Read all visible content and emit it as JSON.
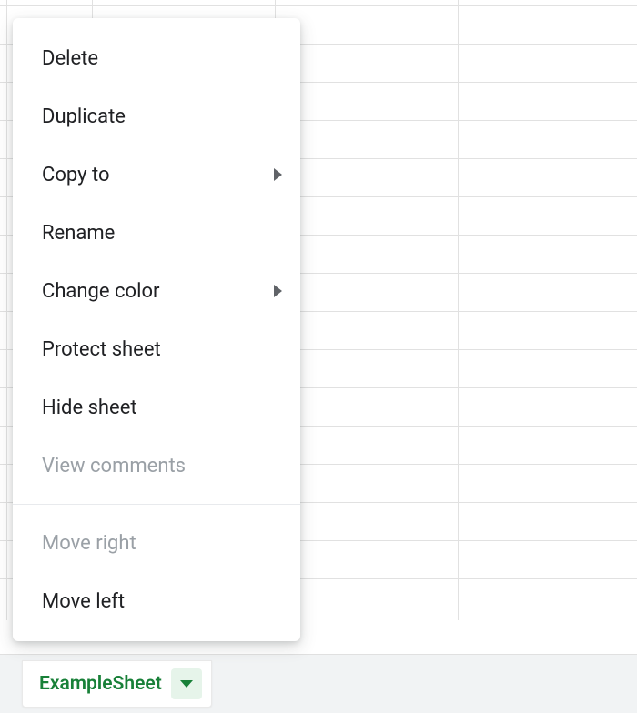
{
  "contextMenu": {
    "items": [
      {
        "label": "Delete",
        "submenu": false,
        "disabled": false
      },
      {
        "label": "Duplicate",
        "submenu": false,
        "disabled": false
      },
      {
        "label": "Copy to",
        "submenu": true,
        "disabled": false
      },
      {
        "label": "Rename",
        "submenu": false,
        "disabled": false
      },
      {
        "label": "Change color",
        "submenu": true,
        "disabled": false
      },
      {
        "label": "Protect sheet",
        "submenu": false,
        "disabled": false
      },
      {
        "label": "Hide sheet",
        "submenu": false,
        "disabled": false
      },
      {
        "label": "View comments",
        "submenu": false,
        "disabled": true
      }
    ],
    "moveGroup": [
      {
        "label": "Move right",
        "disabled": true
      },
      {
        "label": "Move left",
        "disabled": false
      }
    ]
  },
  "tabBar": {
    "activeSheetName": "ExampleSheet"
  },
  "colors": {
    "accent": "#188038",
    "tabBarBg": "#f1f3f4",
    "gridLine": "#e1e1e1",
    "disabledText": "#9aa0a6"
  }
}
